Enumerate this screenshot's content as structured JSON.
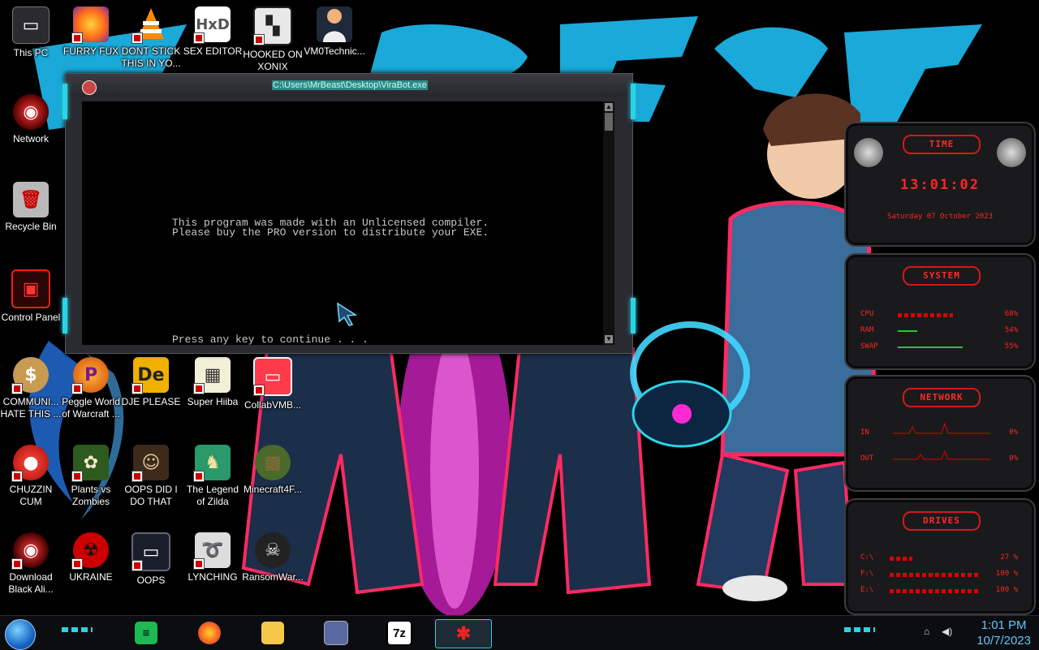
{
  "desktop": {
    "icons": [
      {
        "label": "This PC",
        "icon": "monitor-icon"
      },
      {
        "label": "FURRY FUX",
        "icon": "firefox-icon"
      },
      {
        "label": "DONT STICK THIS IN YO...",
        "icon": "vlc-cone-icon"
      },
      {
        "label": "SEX EDITOR",
        "icon": "hxd-icon"
      },
      {
        "label": "HOOKED ON XONIX",
        "icon": "xonix-icon"
      },
      {
        "label": "VM0Technic...",
        "icon": "doctor-icon"
      },
      {
        "label": "Network",
        "icon": "network-icon"
      },
      {
        "label": "Recycle Bin",
        "icon": "recycle-bin-icon"
      },
      {
        "label": "Control Panel",
        "icon": "control-panel-icon"
      },
      {
        "label": "COMMUNI... HATE THIS ...",
        "icon": "money-bag-icon"
      },
      {
        "label": "Peggle World of Warcraft ...",
        "icon": "peggle-icon"
      },
      {
        "label": "DJE PLEASE",
        "icon": "de-icon"
      },
      {
        "label": "Super Hiiba",
        "icon": "dog-icon"
      },
      {
        "label": "CollabVMB...",
        "icon": "monitor-red-icon"
      },
      {
        "label": "CHUZZIN CUM",
        "icon": "chuzzle-icon"
      },
      {
        "label": "Plants vs Zombies",
        "icon": "plant-icon"
      },
      {
        "label": "OOPS DID I DO THAT",
        "icon": "portrait-icon"
      },
      {
        "label": "The Legend of Zilda",
        "icon": "zelda-icon"
      },
      {
        "label": "Minecraft4F...",
        "icon": "minecraft-icon"
      },
      {
        "label": "Download Black Ali...",
        "icon": "alien-icon"
      },
      {
        "label": "UKRAINE",
        "icon": "radiation-icon"
      },
      {
        "label": "OOPS",
        "icon": "oops-monitor-icon"
      },
      {
        "label": "LYNCHING",
        "icon": "rope-icon"
      },
      {
        "label": "RansomWar...",
        "icon": "skull-icon"
      }
    ]
  },
  "console_window": {
    "title": "C:\\Users\\MrBeast\\Desktop\\ViraBot.exe",
    "lines": [
      "This program was made with an Unlicensed compiler.",
      "Please buy the PRO version to distribute your EXE."
    ],
    "prompt": "Press any key to continue . . ."
  },
  "gadgets": {
    "time": {
      "title": "TIME",
      "clock": "13:01:02",
      "date": "Saturday 07 October 2023"
    },
    "system": {
      "title": "SYSTEM",
      "rows": [
        {
          "label": "CPU",
          "value": "68%",
          "level": 0.68
        },
        {
          "label": "RAM",
          "value": "54%",
          "level": 0.54
        },
        {
          "label": "SWAP",
          "value": "55%",
          "level": 0.55
        }
      ]
    },
    "network": {
      "title": "NETWORK",
      "rows": [
        {
          "label": "IN",
          "value": "0%"
        },
        {
          "label": "OUT",
          "value": "0%"
        }
      ]
    },
    "drives": {
      "title": "DRIVES",
      "rows": [
        {
          "label": "C:\\",
          "value": "27 %",
          "level": 0.27
        },
        {
          "label": "F:\\",
          "value": "100 %",
          "level": 1.0
        },
        {
          "label": "E:\\",
          "value": "100 %",
          "level": 1.0
        }
      ]
    }
  },
  "taskbar": {
    "items": [
      {
        "name": "spotify",
        "icon": "spotify-icon"
      },
      {
        "name": "firefox",
        "icon": "firefox-icon"
      },
      {
        "name": "file-explorer",
        "icon": "folder-icon"
      },
      {
        "name": "control-panel",
        "icon": "control-panel-icon"
      },
      {
        "name": "7zip",
        "icon": "7zip-icon",
        "text": "7z"
      },
      {
        "name": "virabot",
        "icon": "spider-icon"
      }
    ],
    "time": "1:01 PM",
    "date": "10/7/2023"
  },
  "colors": {
    "accent": "#2ad4e6",
    "gadget_red": "#ff2424",
    "clock_blue": "#5ec8ff"
  }
}
